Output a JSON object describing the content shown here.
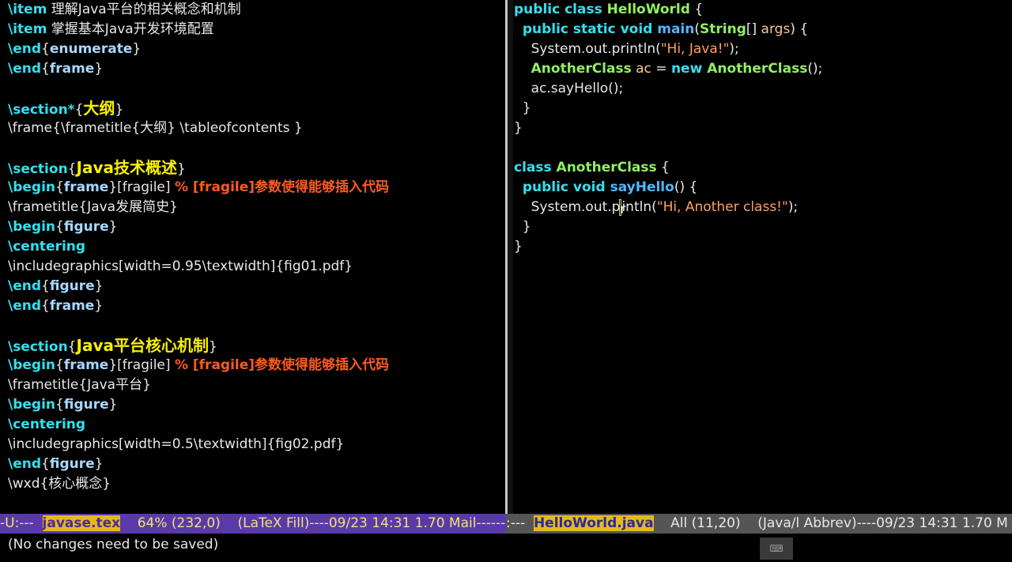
{
  "left_editor": {
    "lines": [
      {
        "kw": "\\item",
        "text": " 理解Java平台的相关概念和机制"
      },
      {
        "kw": "\\item",
        "text": " 掌握基本Java开发环境配置"
      },
      {
        "kw": "\\end",
        "open": "{",
        "arg": "enumerate",
        "close": "}"
      },
      {
        "kw": "\\end",
        "open": "{",
        "arg": "frame",
        "close": "}"
      },
      {},
      {
        "kw": "\\section*",
        "open": "{",
        "big": "大纲",
        "close": "}"
      },
      {
        "text": "\\frame{\\frametitle{大纲} \\tableofcontents }"
      },
      {},
      {
        "kw": "\\section",
        "open": "{",
        "big": "Java技术概述",
        "close": "}"
      },
      {
        "kw": "\\begin",
        "open": "{",
        "arg": "frame",
        "close": "}",
        "after": "[fragile] ",
        "comment": "% [fragile]参数使得能够插入代码"
      },
      {
        "text": "\\frametitle{Java发展简史}"
      },
      {
        "kw": "\\begin",
        "open": "{",
        "arg": "figure",
        "close": "}"
      },
      {
        "kw": "\\centering"
      },
      {
        "text": "\\includegraphics[width=0.95\\textwidth]{fig01.pdf}"
      },
      {
        "kw": "\\end",
        "open": "{",
        "arg": "figure",
        "close": "}"
      },
      {
        "kw": "\\end",
        "open": "{",
        "arg": "frame",
        "close": "}"
      },
      {},
      {
        "kw": "\\section",
        "open": "{",
        "big": "Java平台核心机制",
        "close": "}"
      },
      {
        "kw": "\\begin",
        "open": "{",
        "arg": "frame",
        "close": "}",
        "after": "[fragile] ",
        "comment": "% [fragile]参数使得能够插入代码"
      },
      {
        "text": "\\frametitle{Java平台}"
      },
      {
        "kw": "\\begin",
        "open": "{",
        "arg": "figure",
        "close": "}"
      },
      {
        "kw": "\\centering"
      },
      {
        "text": "\\includegraphics[width=0.5\\textwidth]{fig02.pdf}"
      },
      {
        "kw": "\\end",
        "open": "{",
        "arg": "figure",
        "close": "}"
      },
      {
        "text": "\\wxd{核心概念}"
      }
    ]
  },
  "right_editor": {
    "lines": [
      [
        {
          "c": "kw",
          "t": "public class "
        },
        {
          "c": "ty",
          "t": "HelloWorld"
        },
        {
          "t": " {"
        }
      ],
      [
        {
          "t": "  "
        },
        {
          "c": "kw",
          "t": "public static void "
        },
        {
          "c": "fn",
          "t": "main"
        },
        {
          "t": "("
        },
        {
          "c": "ty",
          "t": "String"
        },
        {
          "t": "[] "
        },
        {
          "c": "var",
          "t": "args"
        },
        {
          "t": ") {"
        }
      ],
      [
        {
          "t": "    System.out.println("
        },
        {
          "c": "str",
          "t": "\"Hi, Java!\""
        },
        {
          "t": ");"
        }
      ],
      [
        {
          "t": "    "
        },
        {
          "c": "ty",
          "t": "AnotherClass"
        },
        {
          "t": " "
        },
        {
          "c": "var",
          "t": "ac"
        },
        {
          "t": " = "
        },
        {
          "c": "kw",
          "t": "new "
        },
        {
          "c": "ty",
          "t": "AnotherClass"
        },
        {
          "t": "();"
        }
      ],
      [
        {
          "t": "    ac.sayHello();"
        }
      ],
      [
        {
          "t": "  }"
        }
      ],
      [
        {
          "t": "}"
        }
      ],
      [],
      [
        {
          "c": "kw",
          "t": "class "
        },
        {
          "c": "ty",
          "t": "AnotherClass"
        },
        {
          "t": " {"
        }
      ],
      [
        {
          "t": "  "
        },
        {
          "c": "kw",
          "t": "public void "
        },
        {
          "c": "fn",
          "t": "sayHello"
        },
        {
          "t": "() {"
        }
      ],
      [
        {
          "t": "    System.out.p"
        },
        {
          "c": "cursor",
          "t": "r"
        },
        {
          "t": "intln("
        },
        {
          "c": "str",
          "t": "\"Hi, Another class!\""
        },
        {
          "t": ");"
        }
      ],
      [
        {
          "t": "  }"
        }
      ],
      [
        {
          "t": "}"
        }
      ]
    ]
  },
  "modeline_left": {
    "prefix": "-U:---  ",
    "buffer": "javase.tex",
    "info": "    64% (232,0)    (LaTeX Fill)----09/23 14:31 1.70 Mail------"
  },
  "modeline_right": {
    "prefix": ":---  ",
    "buffer": "HelloWorld.java",
    "info": "    All (11,20)    (Java/l Abbrev)----09/23 14:31 1.70 M"
  },
  "echo_area": {
    "message": "(No changes need to be saved)"
  },
  "colors": {
    "background": "#000000",
    "modeline_left_bg": "#5a3aa8",
    "modeline_right_bg": "#555555",
    "buffer_name_bg": "#e6b820",
    "keyword": "#33e0f0",
    "section_title": "#f8f000",
    "comment": "#ff5a20",
    "type": "#90f060",
    "function": "#50b8ff",
    "string": "#ffa060"
  },
  "icons": {
    "ime_indicator": "keyboard-icon"
  }
}
